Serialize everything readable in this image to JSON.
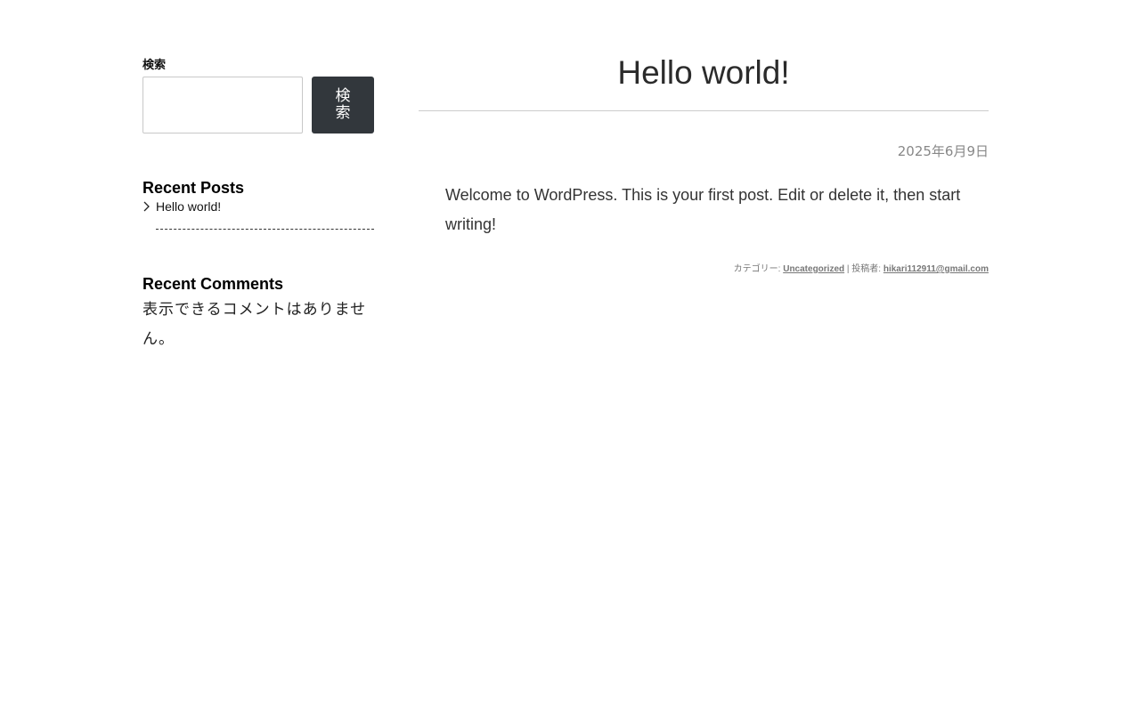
{
  "sidebar": {
    "search": {
      "label": "検索",
      "input_value": "",
      "button_label": "検索"
    },
    "recent_posts": {
      "title": "Recent Posts",
      "items": [
        {
          "label": "Hello world!"
        }
      ]
    },
    "recent_comments": {
      "title": "Recent Comments",
      "empty_text": "表示できるコメントはありません。"
    }
  },
  "post": {
    "title": "Hello world!",
    "date": "2025年6月9日",
    "content": "Welcome to WordPress. This is your first post. Edit or delete it, then start writing!",
    "meta": {
      "category_label": "カテゴリー: ",
      "category": "Uncategorized",
      "separator": " | ",
      "author_label": "投稿者: ",
      "author": "hikari112911@gmail.com"
    }
  },
  "colors": {
    "search_button_bg": "#32373c",
    "text": "#333333",
    "muted": "#888888"
  }
}
